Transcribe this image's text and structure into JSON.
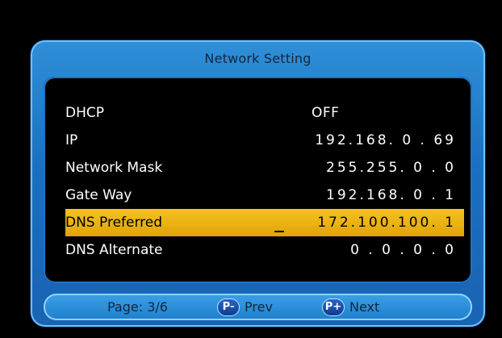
{
  "window": {
    "title": "Network Setting"
  },
  "settings": [
    {
      "label": "DHCP",
      "value": "OFF"
    },
    {
      "label": "IP",
      "value": "192.168. 0 . 69"
    },
    {
      "label": "Network Mask",
      "value": "255.255. 0 . 0"
    },
    {
      "label": "Gate Way",
      "value": "192.168. 0 . 1"
    },
    {
      "label": "DNS Preferred",
      "value": "172.100.100. 1",
      "selected": true
    },
    {
      "label": "DNS Alternate",
      "value": "0 . 0 . 0 . 0"
    }
  ],
  "footer": {
    "page_text": "Page: 3/6",
    "prev_icon_text": "P-",
    "prev_label": "Prev",
    "next_icon_text": "P+",
    "next_label": "Next"
  },
  "colors": {
    "frame_blue": "#1a6fc0",
    "selected_yellow": "#f0b413",
    "panel_black": "#000000"
  }
}
